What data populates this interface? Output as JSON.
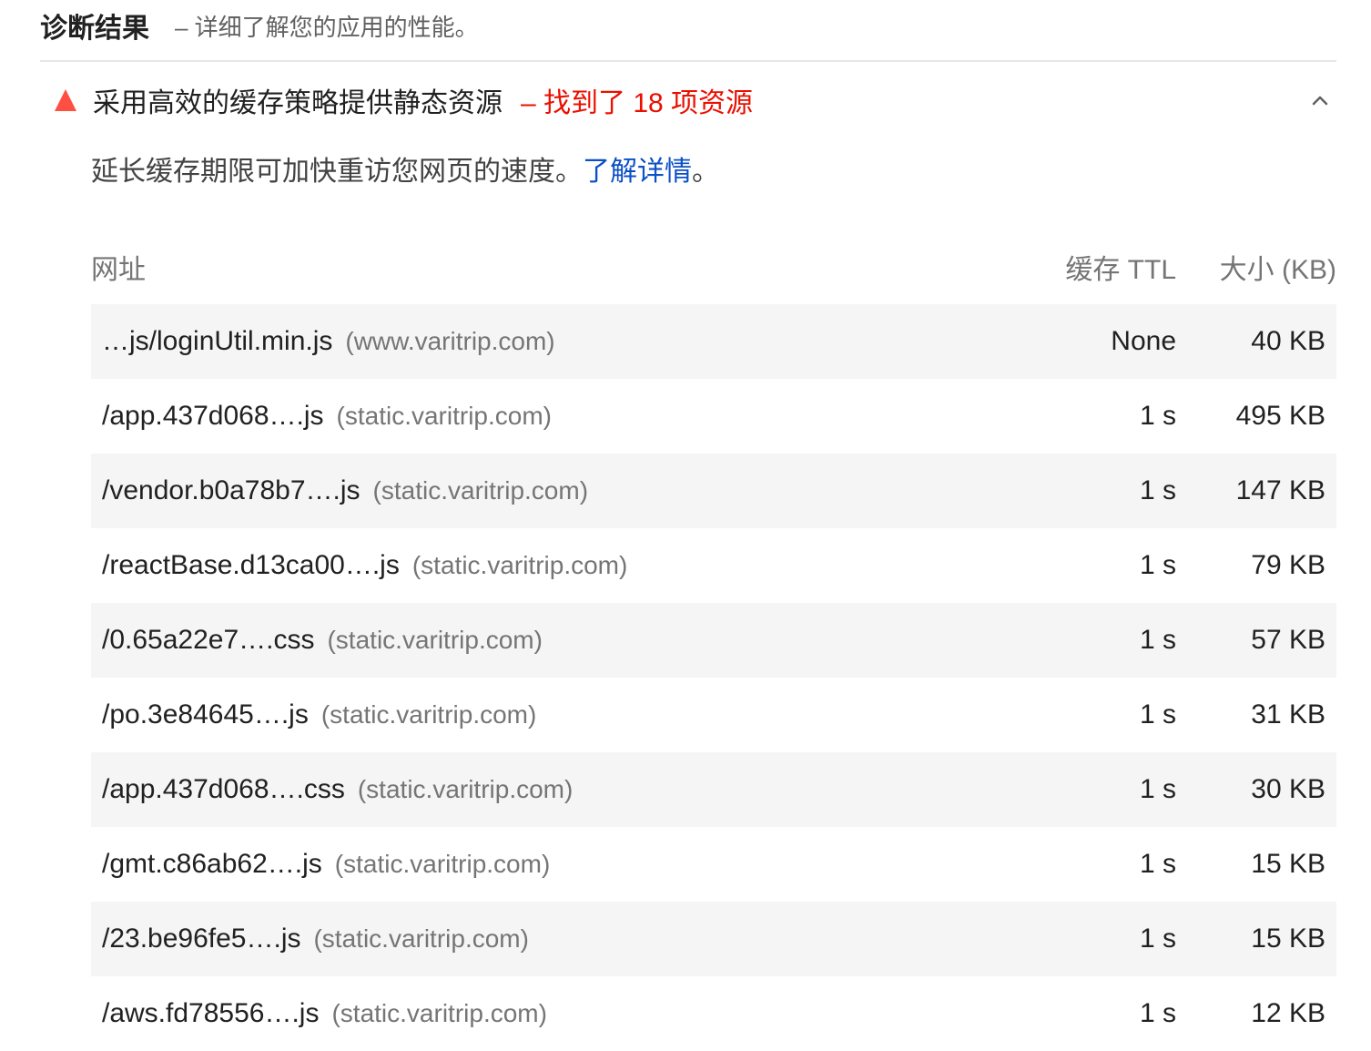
{
  "section": {
    "title": "诊断结果",
    "description": "– 详细了解您的应用的性能。"
  },
  "audit": {
    "title": "采用高效的缓存策略提供静态资源",
    "display_value": "– 找到了 18 项资源",
    "description_text": "延长缓存期限可加快重访您网页的速度。",
    "learn_more": "了解详情",
    "description_end": "。",
    "status_icon": "fail-triangle-icon",
    "status_color": "#ff4e42",
    "display_color": "#eb0f00",
    "link_color": "#0c50c7"
  },
  "table": {
    "headers": {
      "url": "网址",
      "ttl": "缓存 TTL",
      "size": "大小 (KB)"
    },
    "rows": [
      {
        "path": "…js/loginUtil.min.js",
        "host": "(www.varitrip.com)",
        "ttl": "None",
        "size": "40 KB"
      },
      {
        "path": "/app.437d068….js",
        "host": "(static.varitrip.com)",
        "ttl": "1 s",
        "size": "495 KB"
      },
      {
        "path": "/vendor.b0a78b7….js",
        "host": "(static.varitrip.com)",
        "ttl": "1 s",
        "size": "147 KB"
      },
      {
        "path": "/reactBase.d13ca00….js",
        "host": "(static.varitrip.com)",
        "ttl": "1 s",
        "size": "79 KB"
      },
      {
        "path": "/0.65a22e7….css",
        "host": "(static.varitrip.com)",
        "ttl": "1 s",
        "size": "57 KB"
      },
      {
        "path": "/po.3e84645….js",
        "host": "(static.varitrip.com)",
        "ttl": "1 s",
        "size": "31 KB"
      },
      {
        "path": "/app.437d068….css",
        "host": "(static.varitrip.com)",
        "ttl": "1 s",
        "size": "30 KB"
      },
      {
        "path": "/gmt.c86ab62….js",
        "host": "(static.varitrip.com)",
        "ttl": "1 s",
        "size": "15 KB"
      },
      {
        "path": "/23.be96fe5….js",
        "host": "(static.varitrip.com)",
        "ttl": "1 s",
        "size": "15 KB"
      },
      {
        "path": "/aws.fd78556….js",
        "host": "(static.varitrip.com)",
        "ttl": "1 s",
        "size": "12 KB"
      }
    ]
  }
}
